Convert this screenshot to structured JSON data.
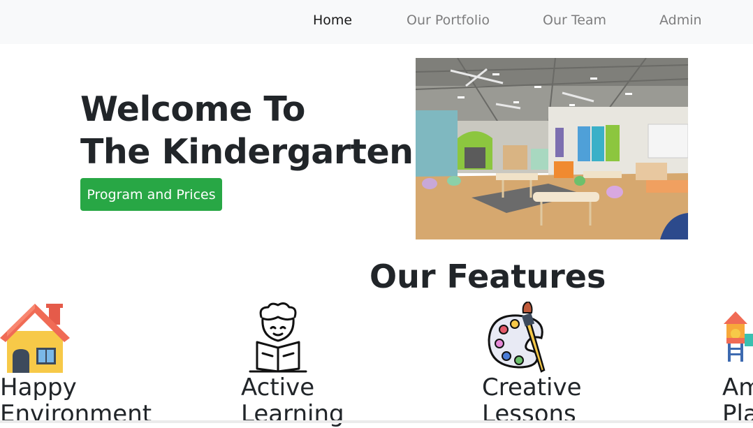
{
  "nav": {
    "items": [
      {
        "label": "Home",
        "active": true
      },
      {
        "label": "Our Portfolio",
        "active": false
      },
      {
        "label": "Our Team",
        "active": false
      },
      {
        "label": "Admin",
        "active": false
      }
    ]
  },
  "hero": {
    "title_line1": "Welcome To",
    "title_line2": "The Kindergarten!",
    "cta_label": "Program and Prices",
    "image": "classroom-photo"
  },
  "features": {
    "title": "Our Features",
    "items": [
      {
        "line1": "Happy",
        "line2": "Environment",
        "icon": "house-icon"
      },
      {
        "line1": "Active",
        "line2": "Learning",
        "icon": "reading-child-icon"
      },
      {
        "line1": "Creative",
        "line2": "Lessons",
        "icon": "paint-palette-icon"
      },
      {
        "line1": "Am",
        "line2": "Pla",
        "icon": "playground-icon"
      }
    ]
  },
  "colors": {
    "navbar_bg": "#f8f9fa",
    "cta_bg": "#28a745",
    "text": "#212529"
  }
}
